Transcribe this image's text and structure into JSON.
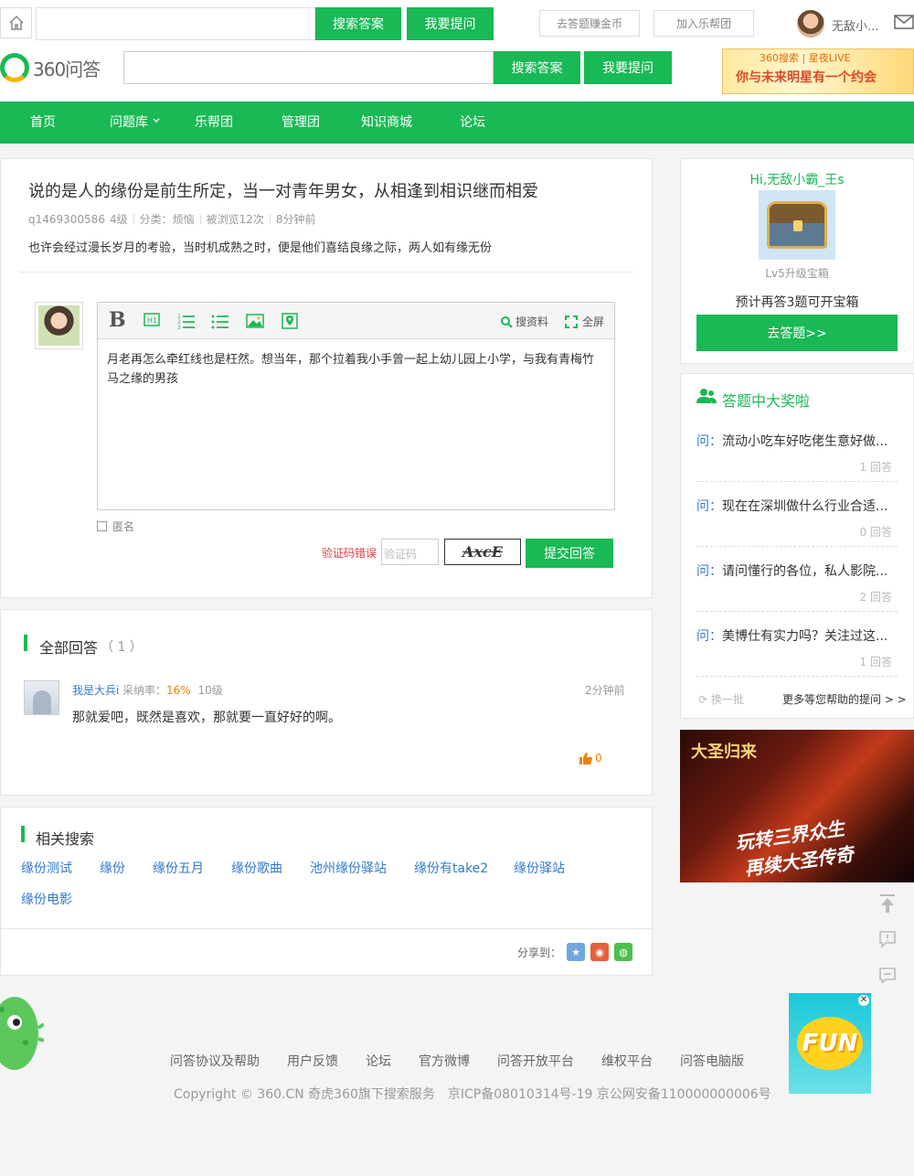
{
  "topbar": {
    "search_button": "搜索答案",
    "ask_button": "我要提问",
    "earn_coins": "去答题赚金币",
    "join_team": "加入乐帮团",
    "username": "无敌小..."
  },
  "header": {
    "logo_text": "360问答",
    "search_button": "搜索答案",
    "ask_button": "我要提问",
    "banner_line1": "360搜索 | 星夜LIVE",
    "banner_line2": "你与未来明星有一个约会"
  },
  "nav": {
    "items": [
      "首页",
      "问题库",
      "乐帮团",
      "管理团",
      "知识商城",
      "论坛"
    ]
  },
  "question": {
    "title": "说的是人的缘份是前生所定，当一对青年男女，从相逢到相识继而相爱",
    "asker": "q1469300586",
    "level": "4级",
    "category": "分类：烦恼",
    "views": "被浏览12次",
    "time": "8分钟前",
    "description": "也许会经过漫长岁月的考验，当时机成熟之时，便是他们喜结良缘之际，两人如有缘无份"
  },
  "editor": {
    "search_material": "搜资料",
    "fullscreen": "全屏",
    "content": "月老再怎么牵红线也是枉然。想当年，那个拉着我小手曾一起上幼儿园上小学，与我有青梅竹马之缘的男孩",
    "anonymous_label": "匿名",
    "captcha_error": "验证码错误",
    "captcha_placeholder": "验证码",
    "captcha_text": "AxcE",
    "submit": "提交回答"
  },
  "answers": {
    "section_title": "全部回答",
    "count": "（ 1 ）",
    "items": [
      {
        "user": "我是大兵i",
        "rate_label": "采纳率：",
        "rate": "16%",
        "level": "10级",
        "time": "2分钟前",
        "text": "那就爱吧，既然是喜欢，那就要一直好好的啊。",
        "likes": "0"
      }
    ]
  },
  "related": {
    "section_title": "相关搜索",
    "links": [
      "缘份测试",
      "缘份",
      "缘份五月",
      "缘份歌曲",
      "池州缘份驿站",
      "缘份有take2",
      "缘份驿站",
      "缘份电影"
    ],
    "share_label": "分享到："
  },
  "sidebar": {
    "greeting": "Hi,无敌小霸_王s",
    "chest_caption": "Lv5升级宝箱",
    "chest_tip": "预计再答3题可开宝箱",
    "go_answer": "去答题>>",
    "award_title": "答题中大奖啦",
    "questions": [
      {
        "prefix": "问：",
        "text": "流动小吃车好吃佬生意好做...",
        "count": "1 回答"
      },
      {
        "prefix": "问：",
        "text": "现在在深圳做什么行业合适...",
        "count": "0 回答"
      },
      {
        "prefix": "问：",
        "text": "请问懂行的各位，私人影院...",
        "count": "2 回答"
      },
      {
        "prefix": "问：",
        "text": "美博仕有实力吗？关注过这...",
        "count": "1 回答"
      }
    ],
    "refresh": "换一批",
    "more": "更多等您帮助的提问 > >",
    "ad_title": "大圣归来",
    "ad_line1": "玩转三界众生",
    "ad_line2": "再续大圣传奇"
  },
  "footer": {
    "links": [
      "问答协议及帮助",
      "用户反馈",
      "论坛",
      "官方微博",
      "问答开放平台",
      "维权平台",
      "问答电脑版"
    ],
    "copyright": "Copyright © 360.CN 奇虎360旗下搜索服务　京ICP备08010314号-19 京公网安备110000000006号",
    "fun_ad": "FUN"
  },
  "colors": {
    "brand_green": "#19b955",
    "link_blue": "#3079ce",
    "error_red": "#e4393c",
    "accent_orange": "#f08200"
  }
}
